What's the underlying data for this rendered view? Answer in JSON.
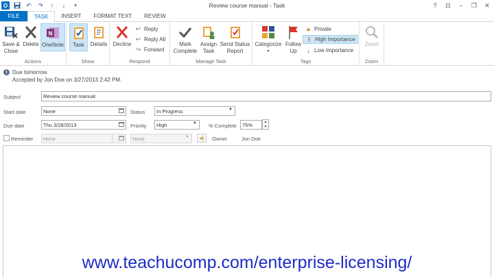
{
  "window": {
    "title": "Review course manual - Task",
    "controls": [
      "?",
      "⊡",
      "–",
      "❐",
      "✕"
    ]
  },
  "qat": [
    "save-icon",
    "undo-icon",
    "redo-icon",
    "up-icon",
    "down-icon",
    "customize-icon"
  ],
  "tabs": [
    "FILE",
    "TASK",
    "INSERT",
    "FORMAT TEXT",
    "REVIEW"
  ],
  "ribbon": {
    "actions": {
      "label": "Actions",
      "save_close": "Save &\nClose",
      "delete": "Delete",
      "onenote": "OneNote"
    },
    "show": {
      "label": "Show",
      "task": "Task",
      "details": "Details"
    },
    "respond": {
      "label": "Respond",
      "decline": "Decline",
      "reply": "Reply",
      "reply_all": "Reply All",
      "forward": "Forward"
    },
    "manage_task": {
      "label": "Manage Task",
      "mark_complete": "Mark\nComplete",
      "assign_task": "Assign\nTask",
      "send_status": "Send Status\nReport"
    },
    "tags": {
      "label": "Tags",
      "categorize": "Categorize",
      "follow_up": "Follow\nUp",
      "private": "Private",
      "high_importance": "High Importance",
      "low_importance": "Low Importance"
    },
    "zoom": {
      "label": "Zoom",
      "zoom": "Zoom"
    }
  },
  "info": {
    "line1": "Due tomorrow.",
    "line2": "Accepted by Jon Doe on 3/27/2013 2:42 PM."
  },
  "form": {
    "subject_label": "Subject",
    "subject_value": "Review course manual",
    "start_date_label": "Start date",
    "start_date_value": "None",
    "due_date_label": "Due date",
    "due_date_value": "Thu 3/28/2013",
    "status_label": "Status",
    "status_value": "In Progress",
    "priority_label": "Priority",
    "priority_value": "High",
    "complete_label": "% Complete",
    "complete_value": "75%",
    "reminder_label": "Reminder",
    "reminder_date": "None",
    "reminder_time": "None",
    "owner_label": "Owner",
    "owner_value": "Jon Doe"
  },
  "footer": {
    "url": "www.teachucomp.com/enterprise-licensing/"
  },
  "colors": {
    "accent": "#0072c6",
    "selected": "#cde6f7",
    "url": "#1c2cc4"
  }
}
